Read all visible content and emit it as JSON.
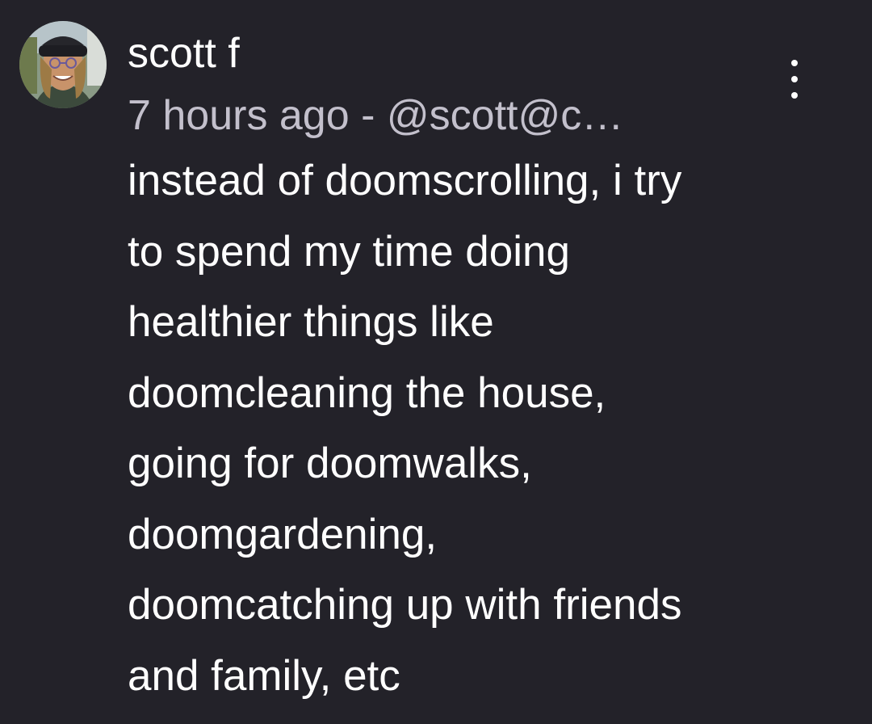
{
  "post": {
    "author_name": "scott f",
    "timestamp": "7 hours ago",
    "separator": " - ",
    "handle": "@scott@c…",
    "more_icon": "vertical-ellipsis-icon",
    "avatar_icon": "user-avatar-photo",
    "body_lines": [
      "instead of doomscrolling, i try",
      "to spend my time doing",
      "healthier things like",
      "doomcleaning the house,",
      "going for doomwalks,",
      "doomgardening,",
      "doomcatching up with friends",
      "and family, etc"
    ]
  },
  "colors": {
    "background": "#232229",
    "primary_text": "#ffffff",
    "secondary_text": "#c3c0cc"
  }
}
